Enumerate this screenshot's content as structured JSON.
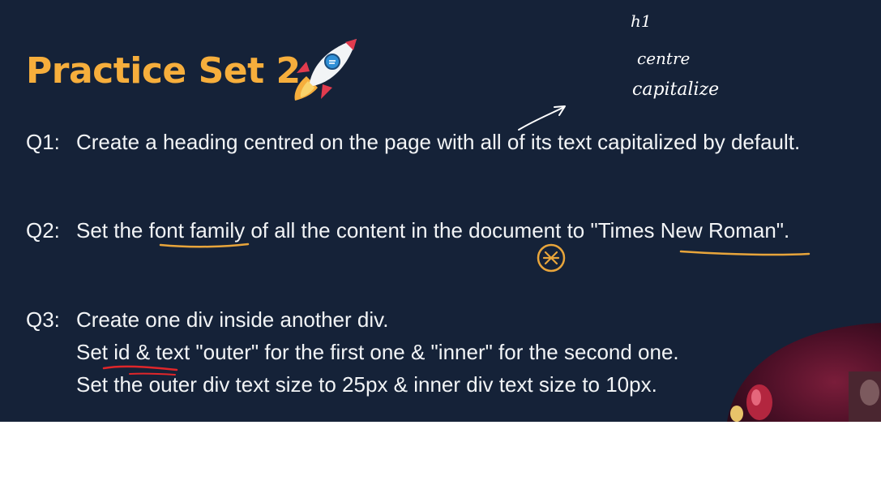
{
  "slide": {
    "title": "Practice Set 2",
    "questions": [
      {
        "number": "Q1:",
        "lines": [
          "Create a heading centred on the page with all of its text capitalized by default."
        ]
      },
      {
        "number": "Q2:",
        "lines": [
          "Set the font family of all the content in the document to \"Times New Roman\"."
        ]
      },
      {
        "number": "Q3:",
        "lines": [
          "Create one div inside another div.",
          "Set id & text \"outer\" for the first one & \"inner\" for the second one.",
          "Set the outer div text size to 25px & inner div text size to 10px."
        ]
      }
    ],
    "handwritten_notes": [
      "h1",
      "centre",
      "capitalize"
    ],
    "icons": [
      "rocket-icon",
      "asterisk-circle-icon",
      "arrow-icon"
    ]
  },
  "colors": {
    "background": "#152238",
    "title": "#f6ae3c",
    "text": "#f2f4f6",
    "annotation_orange": "#e8a53b",
    "annotation_red": "#e0262a",
    "below_slide": "#ffffff"
  }
}
